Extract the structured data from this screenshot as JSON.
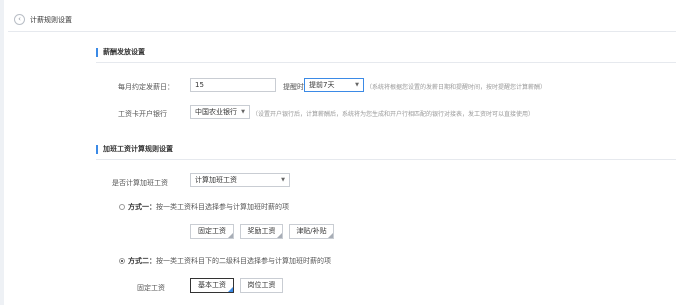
{
  "header": {
    "back_icon": "chevron-left-icon",
    "title": "计薪规则设置"
  },
  "salary_section": {
    "title": "薪酬发放设置",
    "payday_label": "每月约定发薪日：",
    "payday_value": "15",
    "reminder_label": "提醒时间",
    "reminder_value": "提前7天",
    "reminder_hint": "（系统将根据您设置的发薪日期和提醒时间，按时提醒您计算薪酬）",
    "bank_label": "工资卡开户银行",
    "bank_value": "中国农业银行",
    "bank_hint": "（设置开户银行后，计算薪酬后，系统将为您生成和开户行相匹配的银行对接表，发工资时可以直接使用）"
  },
  "overtime_section": {
    "title": "加班工资计算规则设置",
    "calc_label": "是否计算加班工资",
    "calc_value": "计算加班工资",
    "method1_prefix": "方式一：",
    "method1_text": "按一类工资科目选择参与计算加班时薪的项",
    "method1_checked": false,
    "method1_items": [
      "固定工资",
      "奖励工资",
      "津贴/补贴"
    ],
    "method2_prefix": "方式二：",
    "method2_text": "按一类工资科目下的二级科目选择参与计算加班时薪的项",
    "method2_checked": true,
    "fixed_label": "固定工资",
    "method2_items": [
      "基本工资",
      "岗位工资"
    ],
    "method2_selected": "基本工资"
  }
}
